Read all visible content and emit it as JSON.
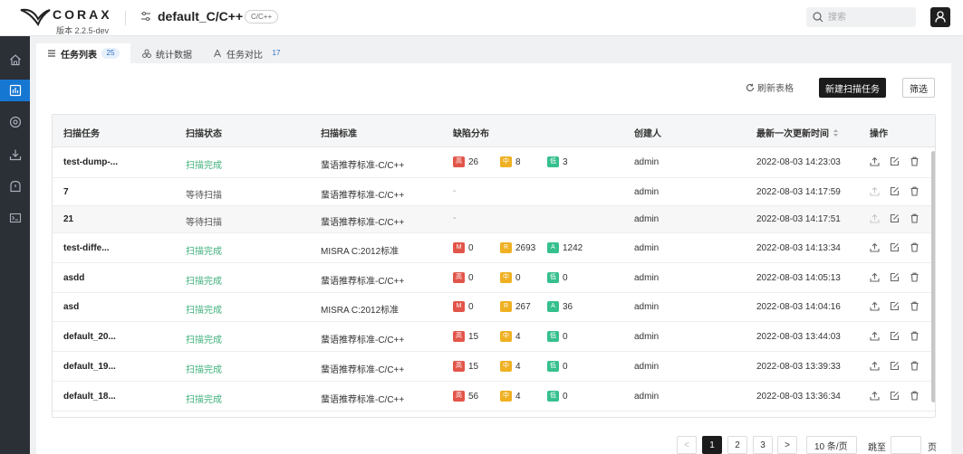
{
  "header": {
    "logo_text": "CORAX",
    "version": "版本 2.2.5-dev",
    "project_name": "default_C/C++",
    "project_lang": "C/C++",
    "search_placeholder": "搜索"
  },
  "tabs": [
    {
      "label": "任务列表",
      "count": "25"
    },
    {
      "label": "统计数据",
      "count": ""
    },
    {
      "label": "任务对比",
      "count": "17"
    }
  ],
  "toolbar": {
    "refresh_label": "刷新表格",
    "new_label": "新建扫描任务",
    "filter_label": "筛选"
  },
  "table": {
    "headers": {
      "task": "扫描任务",
      "status": "扫描状态",
      "standard": "扫描标准",
      "defects": "缺陷分布",
      "creator": "创建人",
      "updated": "最新一次更新时间",
      "ops": "操作"
    },
    "rows": [
      {
        "task": "test-dump-...",
        "status": "扫描完成",
        "done": true,
        "standard": "蜚语推荐标准-C/C++",
        "defects": [
          {
            "label": "高",
            "value": "26",
            "color": "red"
          },
          {
            "label": "中",
            "value": "8",
            "color": "yel"
          },
          {
            "label": "低",
            "value": "3",
            "color": "grn"
          }
        ],
        "creator": "admin",
        "updated": "2022-08-03 14:23:03"
      },
      {
        "task": "7",
        "status": "等待扫描",
        "done": false,
        "standard": "蜚语推荐标准-C/C++",
        "defects_text": "-",
        "creator": "admin",
        "updated": "2022-08-03 14:17:59"
      },
      {
        "task": "21",
        "status": "等待扫描",
        "done": false,
        "standard": "蜚语推荐标准-C/C++",
        "defects_text": "-",
        "creator": "admin",
        "updated": "2022-08-03 14:17:51"
      },
      {
        "task": "test-diffe...",
        "status": "扫描完成",
        "done": true,
        "standard": "MISRA C:2012标准",
        "defects": [
          {
            "label": "M",
            "value": "0",
            "color": "red"
          },
          {
            "label": "R",
            "value": "2693",
            "color": "yel"
          },
          {
            "label": "A",
            "value": "1242",
            "color": "grn"
          }
        ],
        "creator": "admin",
        "updated": "2022-08-03 14:13:34"
      },
      {
        "task": "asdd",
        "status": "扫描完成",
        "done": true,
        "standard": "蜚语推荐标准-C/C++",
        "defects": [
          {
            "label": "高",
            "value": "0",
            "color": "red"
          },
          {
            "label": "中",
            "value": "0",
            "color": "yel"
          },
          {
            "label": "低",
            "value": "0",
            "color": "grn"
          }
        ],
        "creator": "admin",
        "updated": "2022-08-03 14:05:13"
      },
      {
        "task": "asd",
        "status": "扫描完成",
        "done": true,
        "standard": "MISRA C:2012标准",
        "defects": [
          {
            "label": "M",
            "value": "0",
            "color": "red"
          },
          {
            "label": "R",
            "value": "267",
            "color": "yel"
          },
          {
            "label": "A",
            "value": "36",
            "color": "grn"
          }
        ],
        "creator": "admin",
        "updated": "2022-08-03 14:04:16"
      },
      {
        "task": "default_20...",
        "status": "扫描完成",
        "done": true,
        "standard": "蜚语推荐标准-C/C++",
        "defects": [
          {
            "label": "高",
            "value": "15",
            "color": "red"
          },
          {
            "label": "中",
            "value": "4",
            "color": "yel"
          },
          {
            "label": "低",
            "value": "0",
            "color": "grn"
          }
        ],
        "creator": "admin",
        "updated": "2022-08-03 13:44:03"
      },
      {
        "task": "default_19...",
        "status": "扫描完成",
        "done": true,
        "standard": "蜚语推荐标准-C/C++",
        "defects": [
          {
            "label": "高",
            "value": "15",
            "color": "red"
          },
          {
            "label": "中",
            "value": "4",
            "color": "yel"
          },
          {
            "label": "低",
            "value": "0",
            "color": "grn"
          }
        ],
        "creator": "admin",
        "updated": "2022-08-03 13:39:33"
      },
      {
        "task": "default_18...",
        "status": "扫描完成",
        "done": true,
        "standard": "蜚语推荐标准-C/C++",
        "defects": [
          {
            "label": "高",
            "value": "56",
            "color": "red"
          },
          {
            "label": "中",
            "value": "4",
            "color": "yel"
          },
          {
            "label": "低",
            "value": "0",
            "color": "grn"
          }
        ],
        "creator": "admin",
        "updated": "2022-08-03 13:36:34"
      }
    ]
  },
  "pagination": {
    "prev": "<",
    "pages": [
      "1",
      "2",
      "3"
    ],
    "current": "1",
    "next": ">",
    "page_size": "10 条/页",
    "jump_label": "跳至",
    "page_label": "页"
  },
  "colors": {
    "accent": "#1677d2",
    "success": "#3fb07a",
    "high": "#e2554a",
    "medium": "#efb022",
    "low": "#36c08e"
  },
  "icons": [
    "home-icon",
    "chart-icon",
    "settings-icon",
    "download-icon",
    "shield-icon",
    "terminal-icon",
    "search-icon",
    "user-icon",
    "refresh-icon",
    "sort-icon",
    "upload-icon",
    "edit-icon",
    "delete-icon"
  ]
}
